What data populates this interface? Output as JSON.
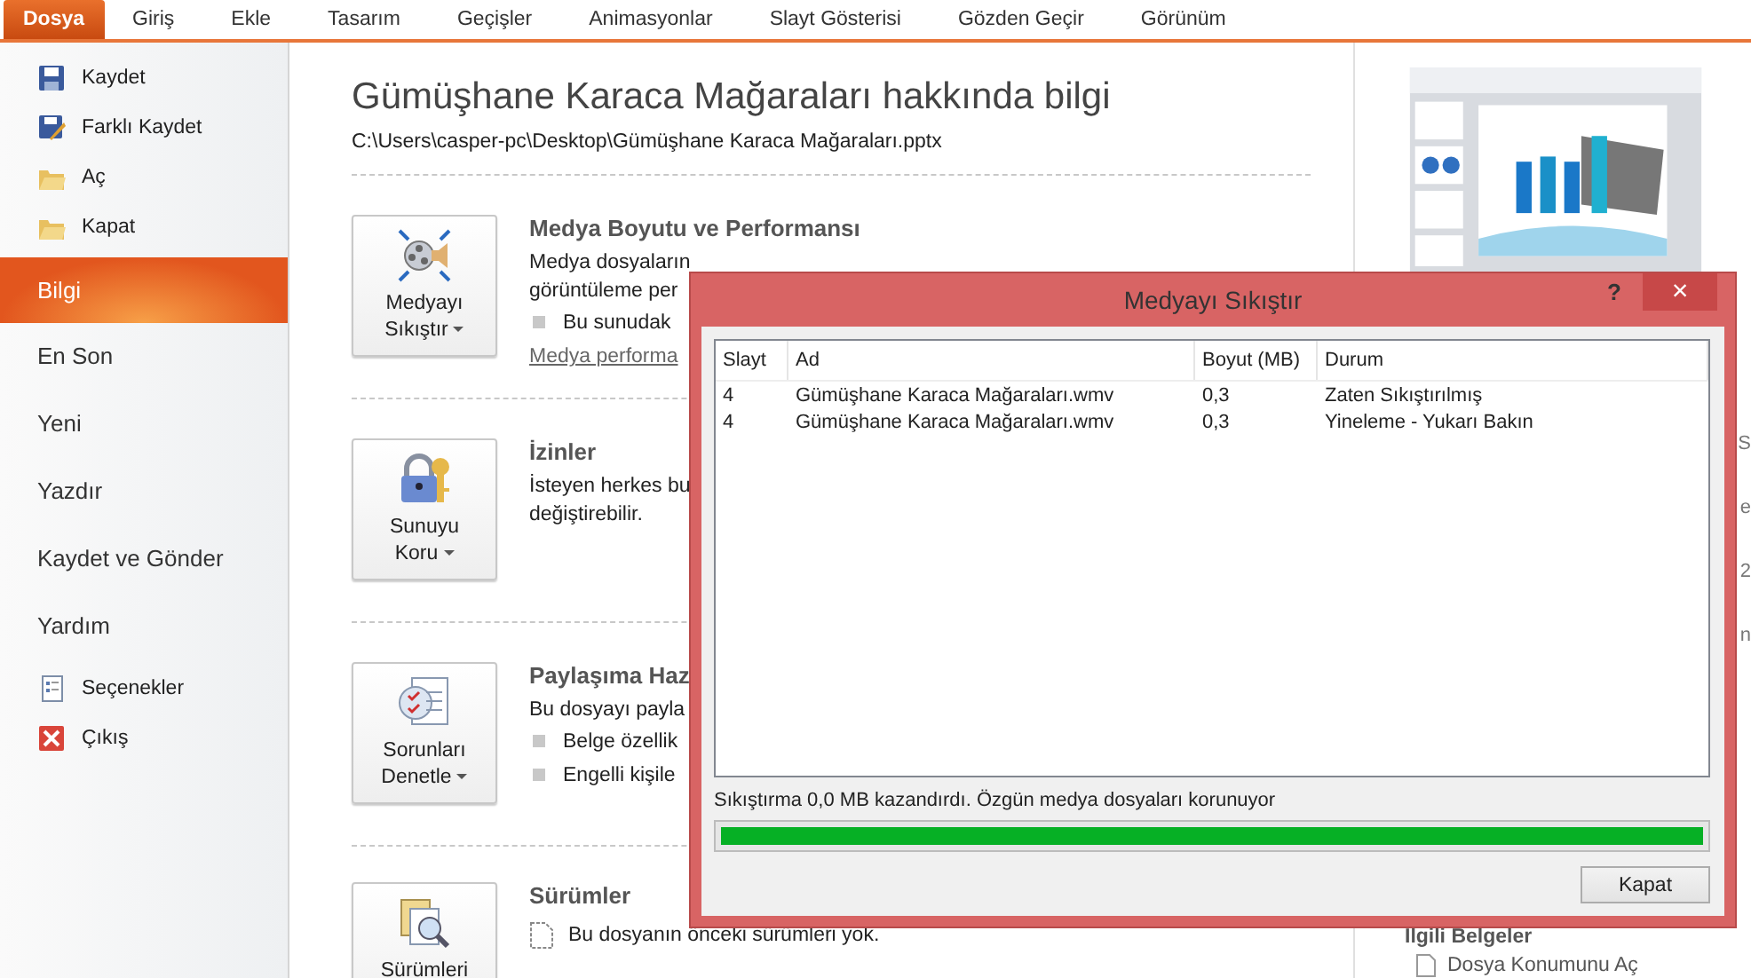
{
  "tabs": [
    {
      "label": "Dosya",
      "selected": true
    },
    {
      "label": "Giriş",
      "selected": false
    },
    {
      "label": "Ekle",
      "selected": false
    },
    {
      "label": "Tasarım",
      "selected": false
    },
    {
      "label": "Geçişler",
      "selected": false
    },
    {
      "label": "Animasyonlar",
      "selected": false
    },
    {
      "label": "Slayt Gösterisi",
      "selected": false
    },
    {
      "label": "Gözden Geçir",
      "selected": false
    },
    {
      "label": "Görünüm",
      "selected": false
    }
  ],
  "nav": [
    {
      "label": "Kaydet",
      "kind": "icon",
      "selected": false
    },
    {
      "label": "Farklı Kaydet",
      "kind": "icon",
      "selected": false
    },
    {
      "label": "Aç",
      "kind": "icon",
      "selected": false
    },
    {
      "label": "Kapat",
      "kind": "icon",
      "selected": false
    },
    {
      "label": "Bilgi",
      "kind": "large",
      "selected": true
    },
    {
      "label": "En Son",
      "kind": "large",
      "selected": false
    },
    {
      "label": "Yeni",
      "kind": "large",
      "selected": false
    },
    {
      "label": "Yazdır",
      "kind": "large",
      "selected": false
    },
    {
      "label": "Kaydet ve Gönder",
      "kind": "large",
      "selected": false
    },
    {
      "label": "Yardım",
      "kind": "large",
      "selected": false
    },
    {
      "label": "Seçenekler",
      "kind": "icon",
      "selected": false
    },
    {
      "label": "Çıkış",
      "kind": "icon",
      "selected": false
    }
  ],
  "info": {
    "title": "Gümüşhane Karaca Mağaraları hakkında bilgi",
    "path": "C:\\Users\\casper-pc\\Desktop\\Gümüşhane Karaca Mağaraları.pptx",
    "sections": [
      {
        "button": [
          "Medyayı",
          "Sıkıştır"
        ],
        "heading": "Medya Boyutu ve Performansı",
        "lines": [
          {
            "kind": "text",
            "text": "Medya dosyaların"
          },
          {
            "kind": "text",
            "text": "görüntüleme per"
          },
          {
            "kind": "bullet",
            "text": "Bu sunudak"
          },
          {
            "kind": "link",
            "text": "Medya performa"
          }
        ]
      },
      {
        "button": [
          "Sunuyu",
          "Koru"
        ],
        "heading": "İzinler",
        "lines": [
          {
            "kind": "text",
            "text": "İsteyen herkes bu"
          },
          {
            "kind": "text",
            "text": "değiştirebilir."
          }
        ]
      },
      {
        "button": [
          "Sorunları",
          "Denetle"
        ],
        "heading": "Paylaşıma Haz",
        "lines": [
          {
            "kind": "text",
            "text": "Bu dosyayı payla"
          },
          {
            "kind": "bullet",
            "text": "Belge özellik"
          },
          {
            "kind": "bullet",
            "text": "Engelli kişile"
          }
        ]
      },
      {
        "button": [
          "Sürümleri"
        ],
        "heading": "Sürümler",
        "lines": [
          {
            "kind": "note",
            "text": "Bu dosyanın önceki sürümleri yok."
          }
        ]
      }
    ]
  },
  "side": {
    "fragments": [
      "S",
      "e",
      "2",
      "n"
    ],
    "related": "İlgili Belgeler",
    "link": "Dosya Konumunu Aç"
  },
  "dialog": {
    "title": "Medyayı Sıkıştır",
    "help": "?",
    "close": "×",
    "columns": [
      "Slayt",
      "Ad",
      "Boyut (MB)",
      "Durum"
    ],
    "rows": [
      [
        "4",
        "Gümüşhane Karaca Mağaraları.wmv",
        "0,3",
        "Zaten Sıkıştırılmış"
      ],
      [
        "4",
        "Gümüşhane Karaca Mağaraları.wmv",
        "0,3",
        "Yineleme - Yukarı Bakın"
      ]
    ],
    "status": "Sıkıştırma 0,0 MB kazandırdı. Özgün medya dosyaları korunuyor",
    "progress": {
      "level": 1
    },
    "button": "Kapat"
  }
}
